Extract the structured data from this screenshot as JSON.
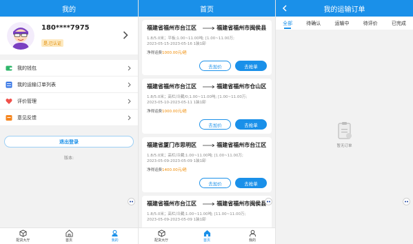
{
  "panel_mine": {
    "title": "我的",
    "phone": "180****7975",
    "verified_badge": "是,已认证",
    "menu": [
      {
        "label": "我的钱包",
        "icon": "wallet-icon",
        "color": "#2fb66a"
      },
      {
        "label": "我的运输订单列表",
        "icon": "list-icon",
        "color": "#3a78e6"
      },
      {
        "label": "评价管理",
        "icon": "heart-icon",
        "color": "#f0504a"
      },
      {
        "label": "意见反馈",
        "icon": "feedback-icon",
        "color": "#f5861f"
      }
    ],
    "logout_label": "退出登录",
    "version_label": "版本:"
  },
  "panel_home": {
    "title": "首页",
    "orders": [
      {
        "from": "福建省福州市台江区",
        "to": "福建省福州市闽侯县",
        "meta1": "1.8/5.0米；平板;1.00~11.00吨; [1.00~11.00万;",
        "meta2": "2023-05-15-2023-05-16 1装1卸",
        "price_label": "净得运费",
        "price_value": "1000.00元/趟",
        "bid": "去加价",
        "grab": "去抢单"
      },
      {
        "from": "福建省福州市台江区",
        "to": "福建省福州市仓山区",
        "meta1": "1.8/5.0米；高栏/冷藏/0;1.00~11.00吨; [1.00~11.00万;",
        "meta2": "2023-05-10-2023-05-11 1装1卸",
        "price_label": "净得运费",
        "price_value": "1000.00元/趟",
        "bid": "去加价",
        "grab": "去抢单"
      },
      {
        "from": "福建省厦门市思明区",
        "to": "福建省福州市台江区",
        "meta1": "1.8/5.0米；高栏/冷藏;1.00~11.00吨; [1.00~11.00万;",
        "meta2": "2023-05-09-2023-05-09 1装1卸",
        "price_label": "净得运费",
        "price_value": "1400.00元/趟",
        "bid": "去加价",
        "grab": "去抢单"
      },
      {
        "from": "福建省福州市台江区",
        "to": "福建省福州市闽侯县",
        "meta1": "1.8/5.0米；高栏/冷藏;1.00~11.00吨; [11.00~11.00万;",
        "meta2": "2023-05-09-2023-05-09 1装1卸"
      }
    ]
  },
  "panel_orders": {
    "title": "我的运输订单",
    "tabs": [
      "全部",
      "待确认",
      "运输中",
      "待评价",
      "已完成"
    ],
    "empty_text": "暂无订单"
  },
  "tabbar": {
    "items": [
      {
        "label": "配货大厅",
        "icon": "cube-icon"
      },
      {
        "label": "首页",
        "icon": "home-icon"
      },
      {
        "label": "我的",
        "icon": "person-icon"
      }
    ]
  },
  "colors": {
    "primary": "#1a90e9",
    "price": "#f08a00",
    "badge_text": "#e08a00"
  }
}
